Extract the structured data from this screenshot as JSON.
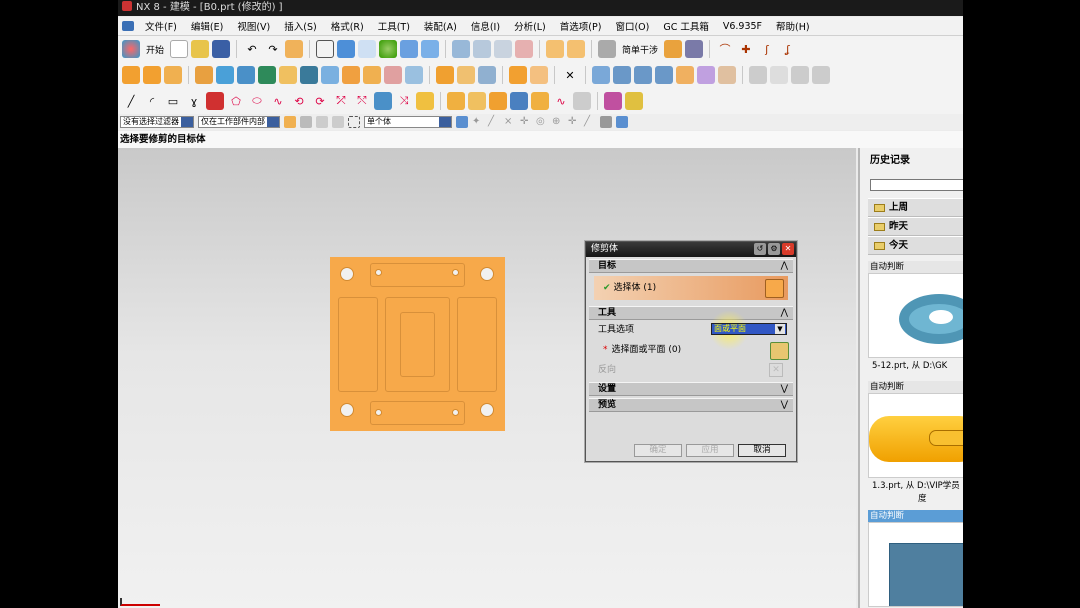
{
  "window": {
    "title": "NX 8 - 建模 - [B0.prt  (修改的) ]"
  },
  "menu": [
    "文件(F)",
    "编辑(E)",
    "视图(V)",
    "插入(S)",
    "格式(R)",
    "工具(T)",
    "装配(A)",
    "信息(I)",
    "分析(L)",
    "首选项(P)",
    "窗口(O)",
    "GC 工具箱",
    "V6.935F",
    "帮助(H)"
  ],
  "toolbar": {
    "start_label": "开始",
    "simple_feature_label": "简单干涉"
  },
  "selection_bar": {
    "filter": "没有选择过滤器",
    "scope": "仅在工作部件内部",
    "body_rule": "单个体"
  },
  "cue_line": "选择要修剪的目标体",
  "dialog": {
    "title": "修剪体",
    "target_section": "目标",
    "select_body": "选择体 (1)",
    "tool_section": "工具",
    "tool_option_label": "工具选项",
    "tool_option_value": "面或平面",
    "select_face": "选择面或平面 (0)",
    "reverse": "反向",
    "settings_section": "设置",
    "preview_section": "预览",
    "ok": "确定",
    "apply": "应用",
    "cancel": "取消"
  },
  "history": {
    "title": "历史记录",
    "groups": [
      "上周",
      "昨天",
      "今天"
    ],
    "cards": [
      {
        "tag": "自动判断",
        "caption": "5-12.prt, 从 D:\\GK"
      },
      {
        "tag": "自动判断",
        "caption": "1.3.prt, 从 D:\\VIP学员",
        "caption2": "度"
      },
      {
        "tag": "自动判断",
        "caption": ""
      }
    ]
  },
  "colors": {
    "part": "#f7a94a",
    "dialog_highlight": "#e89a5f",
    "accent": "#3157c4"
  }
}
